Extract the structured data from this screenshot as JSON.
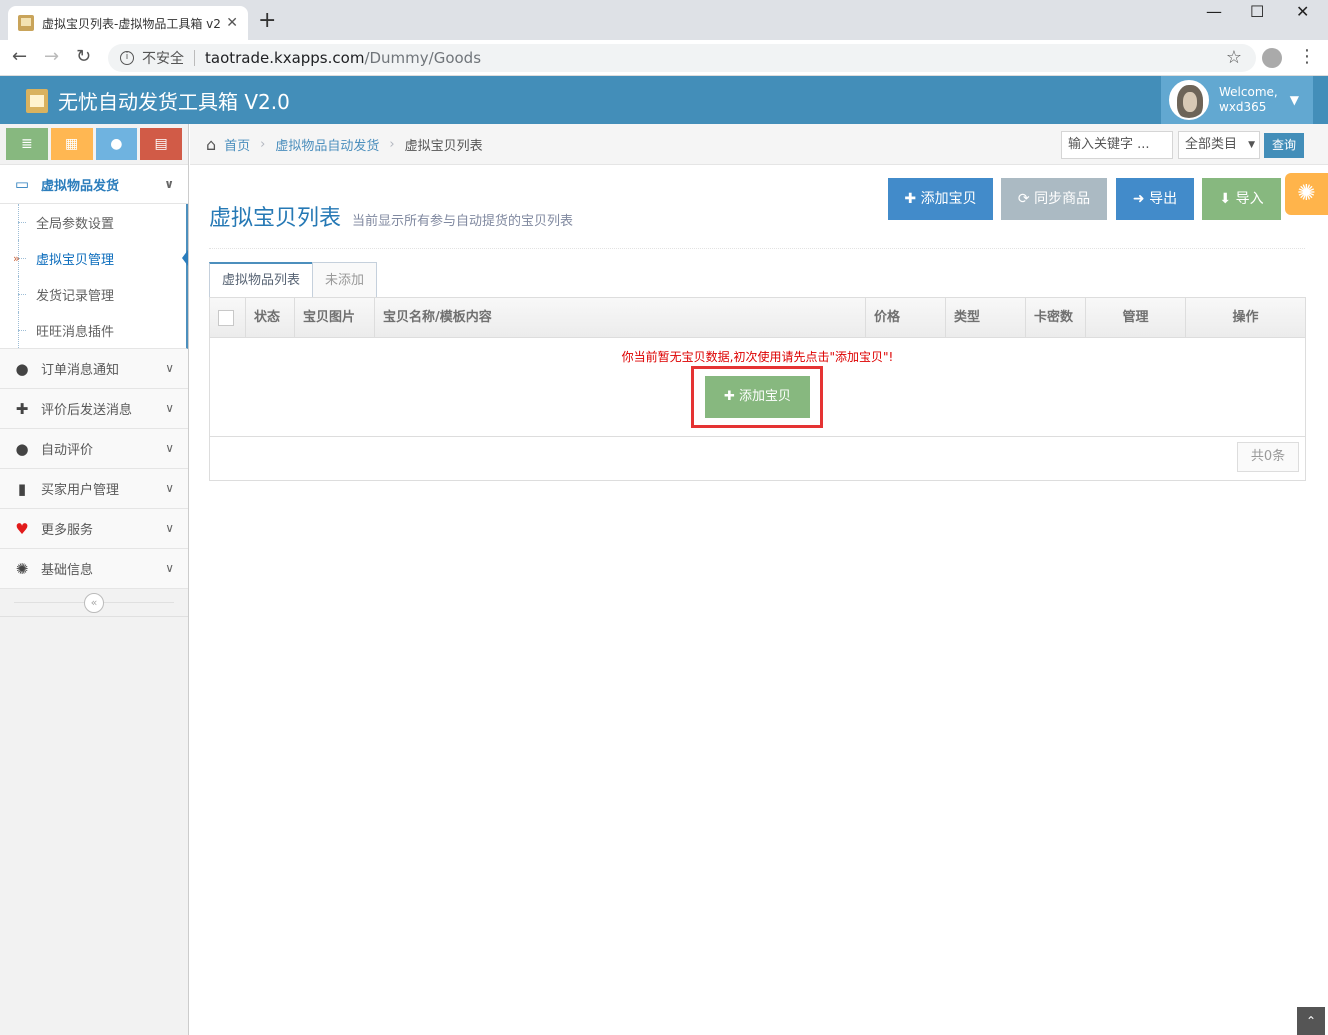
{
  "browser": {
    "tab_title": "虚拟宝贝列表-虚拟物品工具箱 v2",
    "new_tab": "+",
    "insecure_label": "不安全",
    "url_host": "taotrade.kxapps.com",
    "url_path": "/Dummy/Goods"
  },
  "header": {
    "brand": "无忧自动发货工具箱 V2.0",
    "welcome": "Welcome,",
    "username": "wxd365"
  },
  "sidebar": {
    "active_menu": "虚拟物品发货",
    "submenu": [
      "全局参数设置",
      "虚拟宝贝管理",
      "发货记录管理",
      "旺旺消息插件"
    ],
    "menus": [
      "订单消息通知",
      "评价后发送消息",
      "自动评价",
      "买家用户管理",
      "更多服务",
      "基础信息"
    ]
  },
  "breadcrumb": {
    "home": "首页",
    "section": "虚拟物品自动发货",
    "current": "虚拟宝贝列表"
  },
  "search": {
    "placeholder": "输入关键字 ...",
    "category": "全部类目",
    "query_label": "查询"
  },
  "page": {
    "title": "虚拟宝贝列表",
    "subtitle": "当前显示所有参与自动提货的宝贝列表"
  },
  "actions": {
    "add": "添加宝贝",
    "sync": "同步商品",
    "export": "导出",
    "import": "导入"
  },
  "tabs": [
    "虚拟物品列表",
    "未添加"
  ],
  "table": {
    "columns": [
      "状态",
      "宝贝图片",
      "宝贝名称/模板内容",
      "价格",
      "类型",
      "卡密数",
      "管理",
      "操作"
    ],
    "empty_message": "你当前暂无宝贝数据,初次使用请先点击\"添加宝贝\"!",
    "empty_add_button": "添加宝贝",
    "total": "共0条"
  },
  "colors": {
    "navbar": "#438eb9",
    "primary": "#428bca",
    "success": "#87b87f",
    "grey": "#abbac3",
    "warning": "#ffb44b",
    "highlight": "#e53333"
  }
}
